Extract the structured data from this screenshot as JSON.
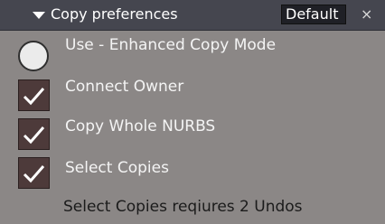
{
  "header": {
    "title": "Copy preferences",
    "preset": "Default",
    "close_glyph": "×",
    "collapse_icon": "triangle-down-icon"
  },
  "options": {
    "enhanced_copy_mode": {
      "label": "Use - Enhanced Copy Mode",
      "checked": false
    },
    "connect_owner": {
      "label": "Connect Owner",
      "checked": true
    },
    "copy_whole_nurbs": {
      "label": "Copy Whole NURBS",
      "checked": true
    },
    "select_copies": {
      "label": "Select Copies",
      "checked": true
    }
  },
  "info": {
    "note": "Select Copies reqiures 2 Undos"
  },
  "colors": {
    "panel_bg": "#8b8786",
    "header_bg": "#45464f",
    "checkbox_bg": "#4d3a3a",
    "radio_fill": "#ebebeb"
  }
}
